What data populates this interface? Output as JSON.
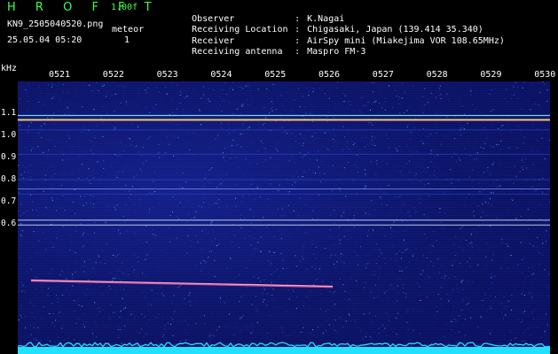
{
  "header": {
    "app_title": "H R O F F T",
    "version": "1.00f",
    "filename": "KN9_2505040520.png",
    "datetime": "25.05.04 05:20",
    "mode_label": "meteor",
    "mode_value": "1",
    "info": [
      {
        "key": "Observer",
        "value": "K.Nagai"
      },
      {
        "key": "Receiving Location",
        "value": "Chigasaki, Japan (139.414 35.340)"
      },
      {
        "key": "Receiver",
        "value": "AirSpy mini (Miakejima VOR 108.65MHz)"
      },
      {
        "key": "Receiving antenna",
        "value": "Maspro FM-3"
      }
    ]
  },
  "axis": {
    "unit": "kHz",
    "time_ticks": [
      "0521",
      "0522",
      "0523",
      "0524",
      "0525",
      "0526",
      "0527",
      "0528",
      "0529",
      "0530"
    ],
    "freq_ticks": [
      {
        "label": "1.1",
        "value": 1.1
      },
      {
        "label": "1.0",
        "value": 1.0
      },
      {
        "label": "0.9",
        "value": 0.9
      },
      {
        "label": "0.8",
        "value": 0.8
      },
      {
        "label": "0.7",
        "value": 0.7
      },
      {
        "label": "0.6",
        "value": 0.6
      }
    ]
  },
  "colors": {
    "title": "#40ff40",
    "text": "#ffffff",
    "background": "#0c1466",
    "carrier_line": "#ffff60",
    "reference_line": "#7fe8ff",
    "meteor_trail": "#ff60a0",
    "bottom_noise": "#22e0ff"
  }
}
